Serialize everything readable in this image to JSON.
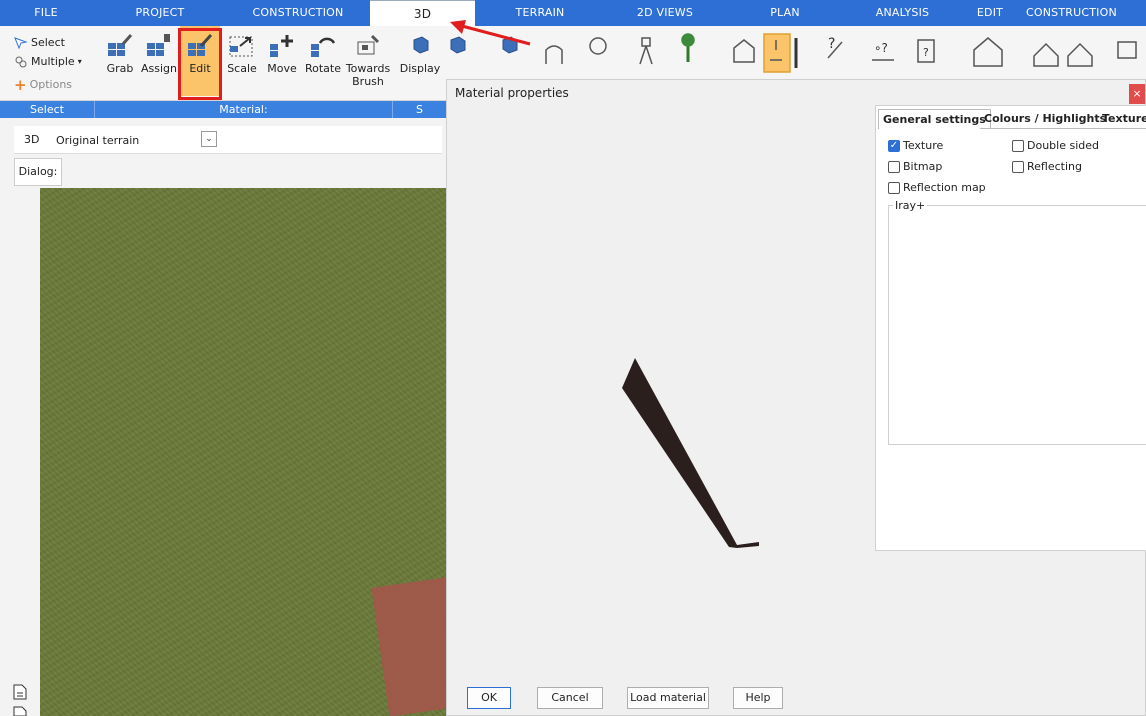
{
  "tabs": [
    {
      "label": "FILE",
      "active": false
    },
    {
      "label": "PROJECT",
      "active": false
    },
    {
      "label": "CONSTRUCTION",
      "active": false
    },
    {
      "label": "3D",
      "active": true
    },
    {
      "label": "TERRAIN",
      "active": false
    },
    {
      "label": "2D VIEWS",
      "active": false
    },
    {
      "label": "PLAN",
      "active": false
    },
    {
      "label": "ANALYSIS",
      "active": false
    },
    {
      "label": "EDIT",
      "active": false
    },
    {
      "label": "CONSTRUCTION ELEVA",
      "active": false
    }
  ],
  "select_group": {
    "select": "Select",
    "multiple": "Multiple",
    "options": "Options",
    "group_label": "Select"
  },
  "material_group": {
    "buttons": [
      {
        "label": "Grab",
        "icon": "grab-material-icon"
      },
      {
        "label": "Assign",
        "icon": "assign-material-icon"
      },
      {
        "label": "Edit",
        "icon": "edit-material-icon"
      },
      {
        "label": "Scale",
        "icon": "scale-material-icon"
      },
      {
        "label": "Move",
        "icon": "move-material-icon"
      },
      {
        "label": "Rotate",
        "icon": "rotate-material-icon"
      },
      {
        "label": "Towards Brush",
        "icon": "towards-brush-icon"
      }
    ],
    "group_label": "Material:",
    "highlighted": "Edit"
  },
  "partial_ribbon": {
    "display_label": "Display",
    "next_group_initial": "S"
  },
  "view_bar": {
    "view_label": "3D",
    "terrain_select": "Original terrain"
  },
  "dialog_label": "Dialog:",
  "material_dialog": {
    "title": "Material properties",
    "close_glyph": "×",
    "settings_tabs": [
      {
        "label": "General settings",
        "active": true
      },
      {
        "label": "Colours / Highlights",
        "active": false
      },
      {
        "label": "Texture",
        "active": false
      }
    ],
    "checkboxes": [
      {
        "label": "Texture",
        "checked": true
      },
      {
        "label": "Double sided",
        "checked": false
      },
      {
        "label": "Bitmap",
        "checked": false
      },
      {
        "label": "Reflecting",
        "checked": false
      },
      {
        "label": "Reflection map",
        "checked": false
      }
    ],
    "fieldset_legend": "Iray+",
    "buttons": {
      "ok": "OK",
      "cancel": "Cancel",
      "load": "Load material",
      "help": "Help"
    }
  },
  "colors": {
    "tabbar": "#2e6fd6",
    "ribbon_group_bar": "#3b82e0",
    "terrain": "#6b7a3a",
    "highlight": "#e01e1e",
    "active_button": "#fcc46a"
  }
}
